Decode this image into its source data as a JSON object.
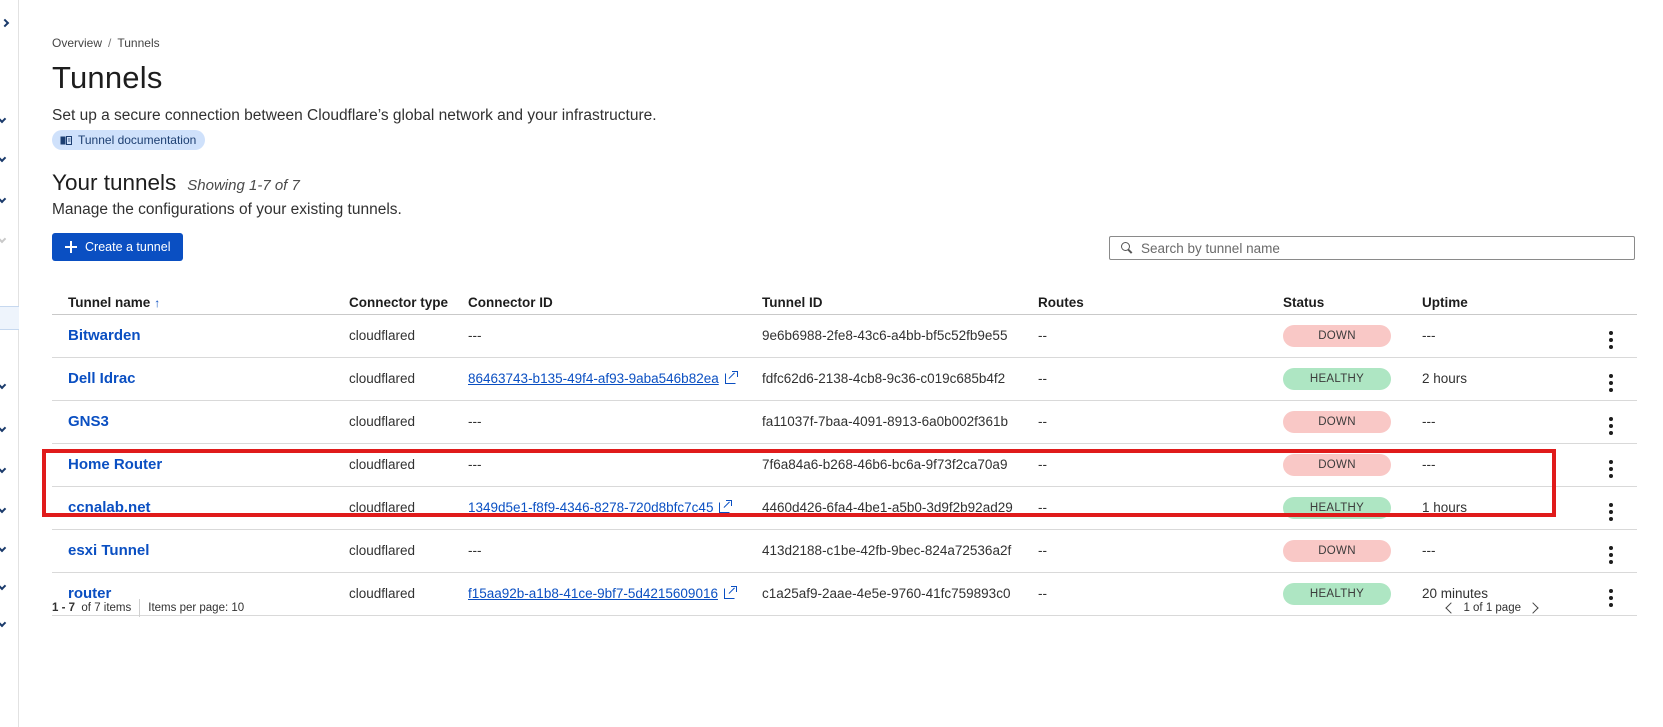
{
  "breadcrumb": {
    "home": "Overview",
    "separator": "/",
    "current": "Tunnels"
  },
  "page": {
    "title": "Tunnels",
    "description": "Set up a secure connection between Cloudflare’s global network and your infrastructure.",
    "doc_link": "Tunnel documentation"
  },
  "section": {
    "title": "Your tunnels",
    "count": "Showing 1-7 of 7",
    "description": "Manage the configurations of your existing tunnels."
  },
  "actions": {
    "create_label": "Create a tunnel"
  },
  "search": {
    "placeholder": "Search by tunnel name",
    "value": ""
  },
  "table": {
    "headers": {
      "name": "Tunnel name",
      "type": "Connector type",
      "connector_id": "Connector ID",
      "tunnel_id": "Tunnel ID",
      "routes": "Routes",
      "status": "Status",
      "uptime": "Uptime"
    },
    "rows": [
      {
        "name": "Bitwarden",
        "type": "cloudflared",
        "connector_id": "---",
        "tunnel_id": "9e6b6988-2fe8-43c6-a4bb-bf5c52fb9e55",
        "routes": "--",
        "status": "DOWN",
        "uptime": "---"
      },
      {
        "name": "Dell Idrac",
        "type": "cloudflared",
        "connector_id": "86463743-b135-49f4-af93-9aba546b82ea",
        "tunnel_id": "fdfc62d6-2138-4cb8-9c36-c019c685b4f2",
        "routes": "--",
        "status": "HEALTHY",
        "uptime": "2 hours"
      },
      {
        "name": "GNS3",
        "type": "cloudflared",
        "connector_id": "---",
        "tunnel_id": "fa11037f-7baa-4091-8913-6a0b002f361b",
        "routes": "--",
        "status": "DOWN",
        "uptime": "---"
      },
      {
        "name": "Home Router",
        "type": "cloudflared",
        "connector_id": "---",
        "tunnel_id": "7f6a84a6-b268-46b6-bc6a-9f73f2ca70a9",
        "routes": "--",
        "status": "DOWN",
        "uptime": "---"
      },
      {
        "name": "ccnalab.net",
        "type": "cloudflared",
        "connector_id": "1349d5e1-f8f9-4346-8278-720d8bfc7c45",
        "tunnel_id": "4460d426-6fa4-4be1-a5b0-3d9f2b92ad29",
        "routes": "--",
        "status": "HEALTHY",
        "uptime": "1 hours"
      },
      {
        "name": "esxi Tunnel",
        "type": "cloudflared",
        "connector_id": "---",
        "tunnel_id": "413d2188-c1be-42fb-9bec-824a72536a2f",
        "routes": "--",
        "status": "DOWN",
        "uptime": "---"
      },
      {
        "name": "router",
        "type": "cloudflared",
        "connector_id": "f15aa92b-a1b8-41ce-9bf7-5d4215609016",
        "tunnel_id": "c1a25af9-2aae-4e5e-9760-41fc759893c0",
        "routes": "--",
        "status": "HEALTHY",
        "uptime": "20 minutes"
      }
    ]
  },
  "pagination": {
    "range": "1 - 7",
    "of_items": "of 7 items",
    "per_page": "Items per page: 10",
    "page_info": "1 of 1 page"
  },
  "colors": {
    "accent": "#0a4fc2",
    "down": "#f9c8c6",
    "healthy": "#aee6c3",
    "highlight": "#e01b1b"
  }
}
